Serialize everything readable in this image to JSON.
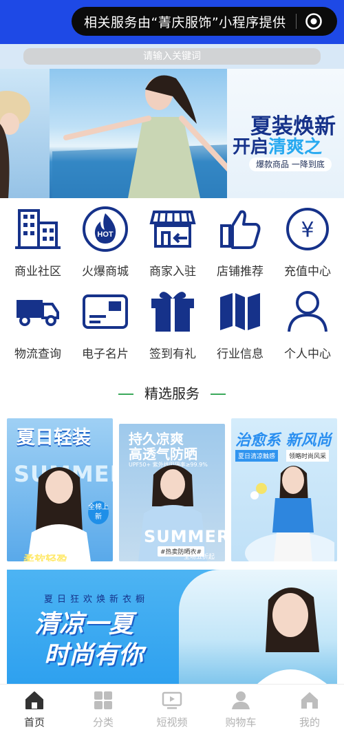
{
  "header": {
    "capsule_text": "相关服务由“菁庆服饰”小程序提供",
    "accent_color": "#1e49e6",
    "action_icon": "target-icon"
  },
  "search": {
    "placeholder": "请输入关键词"
  },
  "banner": {
    "title_line1": "夏装焕新",
    "title_line2_prefix": "开启",
    "title_line2_highlight": "清爽之",
    "tag": "爆款商品 一降到底"
  },
  "grid": {
    "items": [
      {
        "label": "商业社区",
        "icon": "building-icon"
      },
      {
        "label": "火爆商城",
        "icon": "hot-flame-icon",
        "badge": "HOT"
      },
      {
        "label": "商家入驻",
        "icon": "storefront-icon"
      },
      {
        "label": "店铺推荐",
        "icon": "thumbs-up-icon"
      },
      {
        "label": "充值中心",
        "icon": "yen-coin-icon",
        "glyph": "¥"
      },
      {
        "label": "物流查询",
        "icon": "delivery-truck-icon"
      },
      {
        "label": "电子名片",
        "icon": "business-card-icon"
      },
      {
        "label": "签到有礼",
        "icon": "gift-box-icon"
      },
      {
        "label": "行业信息",
        "icon": "map-icon"
      },
      {
        "label": "个人中心",
        "icon": "user-icon"
      }
    ]
  },
  "section": {
    "title": "精选服务"
  },
  "promos": [
    {
      "headline": "夏日轻装",
      "big_text": "SUMMER",
      "badge": "全棉上新",
      "footer": "柔软轻盈"
    },
    {
      "headline": "持久凉爽",
      "subline": "高透气防晒",
      "fine_print": "UPF50+ 紫外线阻隔率≥99.9%",
      "big_text": "SUMMER",
      "tag": "#热卖防晒衣#",
      "footer": "全场五折起"
    },
    {
      "headline": "治愈系 新风尚",
      "tag1": "夏日清凉触感",
      "tag2": "领略时尚风采"
    }
  ],
  "banner2": {
    "small_text": "夏日狂欢焕新衣橱",
    "title_line1": "清凉一夏",
    "title_line2": "时尚有你"
  },
  "tabbar": {
    "items": [
      {
        "label": "首页",
        "icon": "home-icon",
        "active": true
      },
      {
        "label": "分类",
        "icon": "category-icon",
        "active": false
      },
      {
        "label": "短视频",
        "icon": "video-icon",
        "active": false
      },
      {
        "label": "购物车",
        "icon": "cart-user-icon",
        "active": false
      },
      {
        "label": "我的",
        "icon": "home-mine-icon",
        "active": false
      }
    ]
  },
  "colors": {
    "icon_navy": "#16328a",
    "section_line": "#3aa85a",
    "tab_active": "#333333",
    "tab_inactive": "#b2b2b2"
  }
}
